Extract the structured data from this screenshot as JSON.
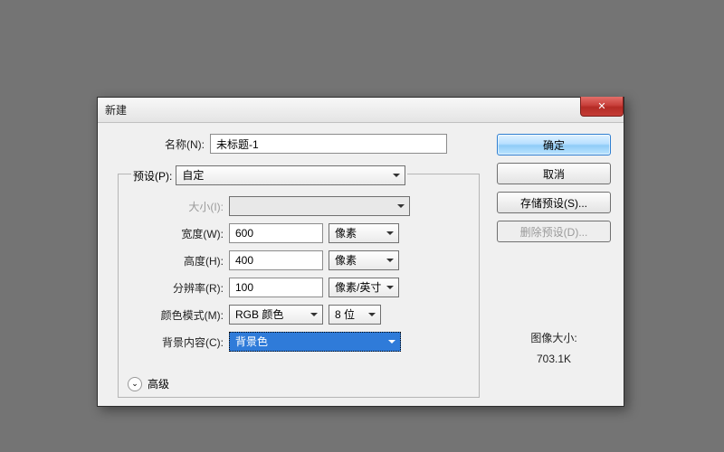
{
  "dialog": {
    "title": "新建",
    "close_symbol": "✕"
  },
  "name": {
    "label": "名称(N):",
    "value": "未标题-1"
  },
  "preset": {
    "label": "预设(P):",
    "value": "自定"
  },
  "size": {
    "label": "大小(I):",
    "value": ""
  },
  "width": {
    "label": "宽度(W):",
    "value": "600",
    "unit": "像素"
  },
  "height": {
    "label": "高度(H):",
    "value": "400",
    "unit": "像素"
  },
  "resolution": {
    "label": "分辨率(R):",
    "value": "100",
    "unit": "像素/英寸"
  },
  "color_mode": {
    "label": "颜色模式(M):",
    "value": "RGB 颜色",
    "depth": "8 位"
  },
  "background": {
    "label": "背景内容(C):",
    "value": "背景色"
  },
  "advanced": {
    "label": "高级",
    "chevron": "⌄"
  },
  "buttons": {
    "ok": "确定",
    "cancel": "取消",
    "save_preset": "存储预设(S)...",
    "delete_preset": "删除预设(D)..."
  },
  "image_size": {
    "label": "图像大小:",
    "value": "703.1K"
  }
}
